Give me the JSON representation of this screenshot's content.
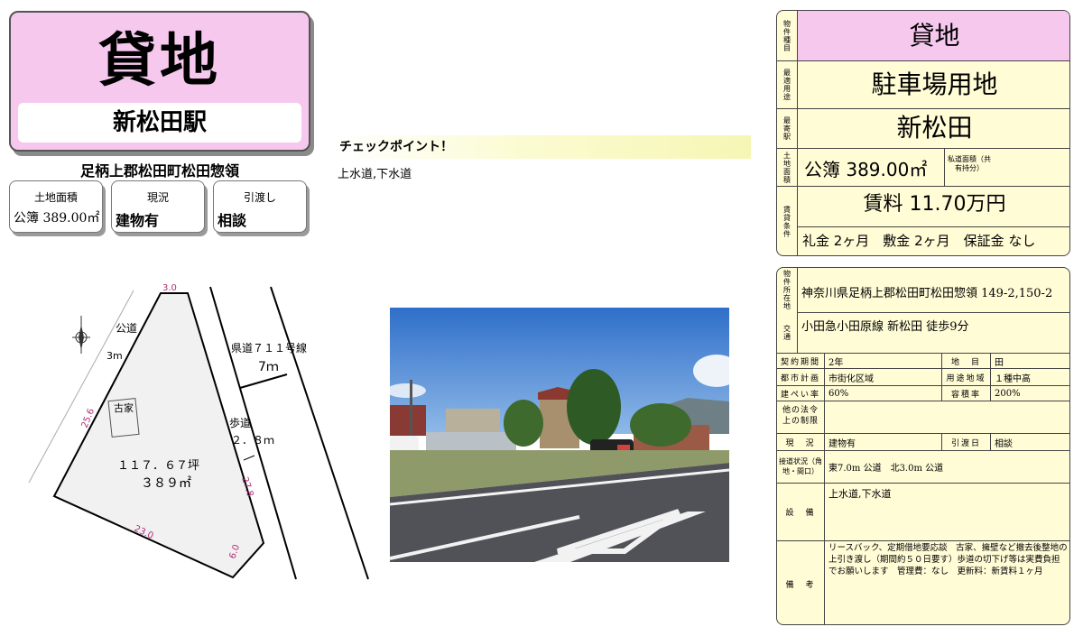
{
  "header": {
    "title": "貸地",
    "station": "新松田駅",
    "address": "足柄上郡松田町松田惣領"
  },
  "summary": {
    "area_label": "土地面積",
    "area_value": "公簿 389.00㎡",
    "status_label": "現況",
    "status_value": "建物有",
    "delivery_label": "引渡し",
    "delivery_value": "相談"
  },
  "checkpoint": {
    "title": "チェックポイント！",
    "body": "上水道,下水道"
  },
  "plot": {
    "road_public": "公道",
    "road_public_width": "3m",
    "prefectural_road": "県道７１１号線",
    "prefectural_road_width": "7ｍ",
    "sidewalk": "歩道",
    "sidewalk_width": "２．８ｍ",
    "old_house": "古家",
    "area_tsubo": "１１７．６７坪",
    "area_sqm": "３８９㎡",
    "dim_top": "3.0",
    "dim_left": "25.6",
    "dim_right": "27.8",
    "dim_bottom": "23.0",
    "dim_corner": "6.0"
  },
  "info": {
    "type_label": "物件種目",
    "type_value": "貸地",
    "use_label": "最適用途",
    "use_value": "駐車場用地",
    "station_label": "最寄駅",
    "station_value": "新松田",
    "area_label": "土地面積",
    "area_value": "公簿 389.00㎡",
    "private_road_label": "私道面積（共有持分）",
    "rent_label": "賃貸条件",
    "rent_value": "賃料 11.70万円",
    "deposit_value": "礼金 2ヶ月　敷金 2ヶ月　保証金 なし"
  },
  "detail": {
    "location_label": "物件所在地",
    "location_value": "神奈川県足柄上郡松田町松田惣領 149-2,150-2",
    "transport_label": "交通",
    "transport_value": "小田急小田原線 新松田 徒歩9分",
    "contract_label": "契約期間",
    "contract_value": "2年",
    "land_cat_label": "地　目",
    "land_cat_value": "田",
    "city_plan_label": "都市計画",
    "city_plan_value": "市街化区域",
    "zoning_label": "用途地域",
    "zoning_value": "１種中高",
    "bcr_label": "建ぺい率",
    "bcr_value": "60%",
    "far_label": "容積率",
    "far_value": "200%",
    "other_law_label": "他の法令上の制限",
    "status_label": "現　況",
    "status_value": "建物有",
    "delivery_label": "引渡日",
    "delivery_value": "相談",
    "access_label": "接道状況（角地・間口）",
    "access_value": "東7.0m 公道　北3.0m 公道",
    "facility_label": "設　備",
    "facility_value": "上水道,下水道",
    "remarks_label": "備　考",
    "remarks_value": "リースバック、定期借地要応談　古家、擁壁など撤去後整地の上引き渡し（期間約５０日要す）歩道の切下げ等は実費負担でお願いします　管理費：なし　更新料：新賃料１ヶ月"
  },
  "colors": {
    "header_pink": "#f6c8ee",
    "table_cream": "#fffcd6",
    "dimension_magenta": "#b0307a"
  }
}
